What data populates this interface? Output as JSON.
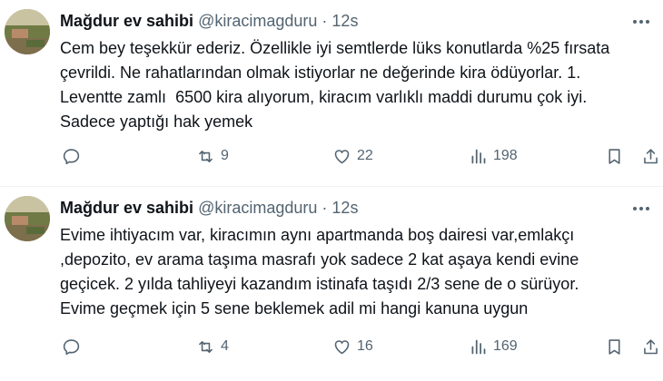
{
  "tweets": [
    {
      "author": {
        "name": "Mağdur ev sahibi",
        "handle": "@kiracimagduru",
        "separator": "·",
        "time": "12s"
      },
      "text_lines": [
        "Cem bey teşekkür ederiz. Özellikle iyi semtlerde lüks konutlarda %25 fırsata",
        "çevrildi. Ne rahatlarından olmak istiyorlar ne değerinde kira ödüyorlar. 1.",
        "Leventte zamlı  6500 kira alıyorum, kiracım varlıklı maddi durumu çok iyi.",
        "Sadece yaptığı hak yemek"
      ],
      "stats": {
        "retweets": "9",
        "likes": "22",
        "views": "198"
      }
    },
    {
      "author": {
        "name": "Mağdur ev sahibi",
        "handle": "@kiracimagduru",
        "separator": "·",
        "time": "12s"
      },
      "text_lines": [
        "Evime ihtiyacım var, kiracımın aynı apartmanda boş dairesi var,emlakçı",
        ",depozito, ev arama taşıma masrafı yok sadece 2 kat aşaya kendi evine",
        "geçicek. 2 yılda tahliyeyi kazandım istinafa taşıdı 2/3 sene de o sürüyor.",
        "Evime geçmek için 5 sene beklemek adil mi hangi kanuna uygun"
      ],
      "stats": {
        "retweets": "4",
        "likes": "16",
        "views": "169"
      }
    }
  ],
  "icons": {
    "more": "more-icon",
    "reply": "reply-icon",
    "retweet": "retweet-icon",
    "like": "heart-icon",
    "views": "views-icon",
    "bookmark": "bookmark-icon",
    "share": "share-icon"
  },
  "colors": {
    "text": "#0f1419",
    "secondary": "#536471",
    "divider": "#eff3f4"
  }
}
